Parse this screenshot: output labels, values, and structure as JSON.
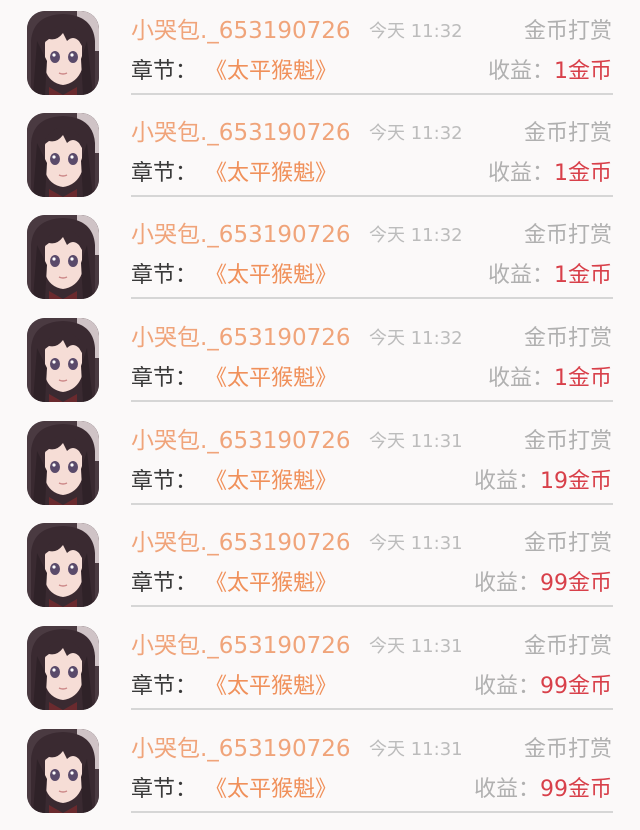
{
  "list": [
    {
      "username": "小哭包._653190726",
      "time": "今天 11:32",
      "type": "金币打赏",
      "chapter_label": "章节：",
      "chapter_title": "《太平猴魁》",
      "earnings_label": "收益：",
      "earnings_value": "1金币"
    },
    {
      "username": "小哭包._653190726",
      "time": "今天 11:32",
      "type": "金币打赏",
      "chapter_label": "章节：",
      "chapter_title": "《太平猴魁》",
      "earnings_label": "收益：",
      "earnings_value": "1金币"
    },
    {
      "username": "小哭包._653190726",
      "time": "今天 11:32",
      "type": "金币打赏",
      "chapter_label": "章节：",
      "chapter_title": "《太平猴魁》",
      "earnings_label": "收益：",
      "earnings_value": "1金币"
    },
    {
      "username": "小哭包._653190726",
      "time": "今天 11:32",
      "type": "金币打赏",
      "chapter_label": "章节：",
      "chapter_title": "《太平猴魁》",
      "earnings_label": "收益：",
      "earnings_value": "1金币"
    },
    {
      "username": "小哭包._653190726",
      "time": "今天 11:31",
      "type": "金币打赏",
      "chapter_label": "章节：",
      "chapter_title": "《太平猴魁》",
      "earnings_label": "收益：",
      "earnings_value": "19金币"
    },
    {
      "username": "小哭包._653190726",
      "time": "今天 11:31",
      "type": "金币打赏",
      "chapter_label": "章节：",
      "chapter_title": "《太平猴魁》",
      "earnings_label": "收益：",
      "earnings_value": "99金币"
    },
    {
      "username": "小哭包._653190726",
      "time": "今天 11:31",
      "type": "金币打赏",
      "chapter_label": "章节：",
      "chapter_title": "《太平猴魁》",
      "earnings_label": "收益：",
      "earnings_value": "99金币"
    },
    {
      "username": "小哭包._653190726",
      "time": "今天 11:31",
      "type": "金币打赏",
      "chapter_label": "章节：",
      "chapter_title": "《太平猴魁》",
      "earnings_label": "收益：",
      "earnings_value": "99金币"
    }
  ],
  "colors": {
    "background": "#fbf9f9",
    "username": "#f0a47a",
    "chapter_title": "#f0905a",
    "earnings_value": "#d8404a",
    "muted": "#b0b0b0",
    "divider": "#d6d6d6"
  },
  "icons": {
    "avatar": "anime-girl-avatar"
  }
}
